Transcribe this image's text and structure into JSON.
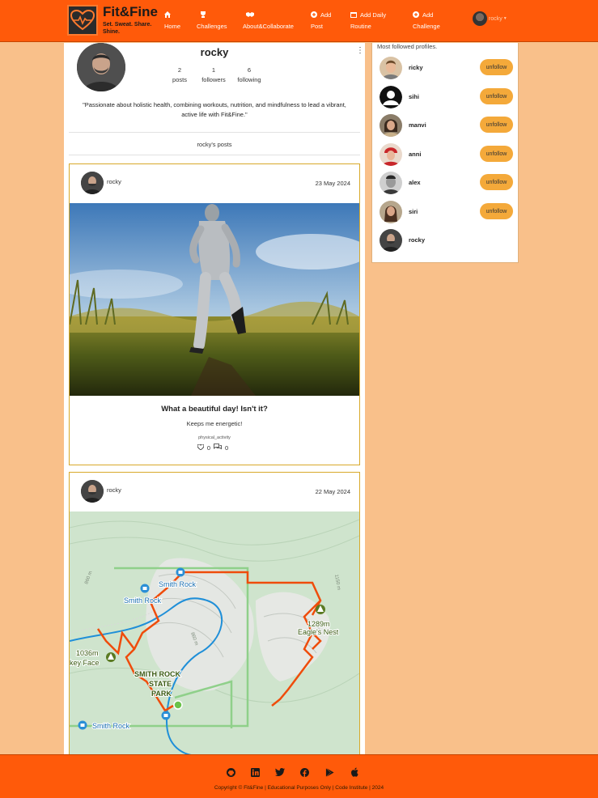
{
  "brand": {
    "title": "Fit&Fine",
    "tagline": "Set. Sweat. Share. Shine."
  },
  "nav": {
    "home": "Home",
    "challenges": "Challenges",
    "about": "About&Collaborate",
    "add_post": "Add Post",
    "add_routine": "Add Daily Routine",
    "add_challenge": "Add Challenge",
    "user": "rocky"
  },
  "profile": {
    "username": "rocky",
    "posts_count": "2",
    "posts_label": "posts",
    "followers_count": "1",
    "followers_label": "followers",
    "following_count": "6",
    "following_label": "following",
    "bio": "\"Passionate about holistic health, combining workouts, nutrition, and mindfulness to lead a vibrant, active life with Fit&Fine.\"",
    "posts_heading": "rocky's posts"
  },
  "posts": [
    {
      "user": "rocky",
      "date": "23 May 2024",
      "title": "What a beautiful day! Isn't it?",
      "body": "Keeps me energetic!",
      "tag": "physical_activity",
      "likes": "0",
      "comments": "0"
    },
    {
      "user": "rocky",
      "date": "22 May 2024"
    }
  ],
  "map_labels": {
    "smith_rock": "Smith Rock",
    "state_park": "SMITH ROCK STATE PARK",
    "eagles_nest": "Eagle's Nest",
    "eagles_elev": "1289m",
    "face_elev": "1036m",
    "face": "key Face",
    "contour_860": "860 m",
    "contour_1150": "1150 m"
  },
  "sidebar": {
    "title": "Most followed profiles.",
    "profiles": [
      {
        "name": "ricky",
        "button": "unfollow"
      },
      {
        "name": "sihi",
        "button": "unfollow"
      },
      {
        "name": "manvi",
        "button": "unfollow"
      },
      {
        "name": "anni",
        "button": "unfollow"
      },
      {
        "name": "alex",
        "button": "unfollow"
      },
      {
        "name": "siri",
        "button": "unfollow"
      },
      {
        "name": "rocky"
      }
    ]
  },
  "footer": {
    "copyright": "Copyright © Fit&Fine | Educational Purposes Only | Code Institute | 2024"
  },
  "colors": {
    "primary": "#ff5a0a",
    "background": "#f9c08a",
    "button": "#f4a93a",
    "post_border": "#d8a92a"
  }
}
